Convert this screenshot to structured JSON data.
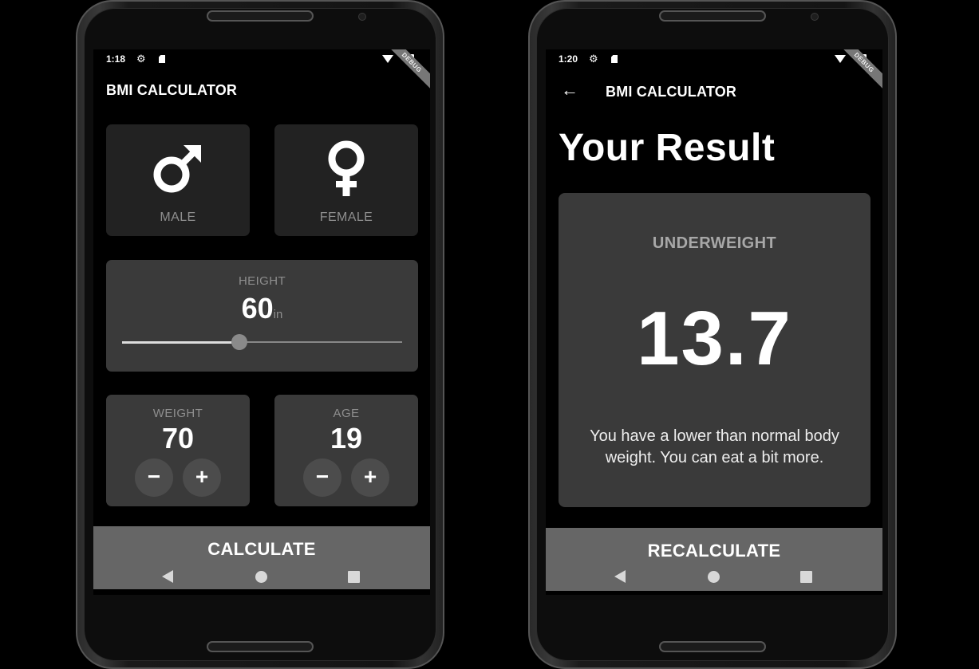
{
  "colors": {
    "background": "#000000",
    "card_inactive": "#222222",
    "card_active": "#3a3a3a",
    "bottom_button": "#666666",
    "label_grey": "#8e8e8e"
  },
  "input_screen": {
    "status_bar": {
      "time": "1:18",
      "debug_banner": "DEBUG"
    },
    "app_bar": {
      "title": "BMI CALCULATOR"
    },
    "gender": {
      "male": {
        "icon": "male-symbol-icon",
        "label": "MALE"
      },
      "female": {
        "icon": "female-symbol-icon",
        "label": "FEMALE"
      }
    },
    "height": {
      "label": "HEIGHT",
      "value": "60",
      "unit": "in",
      "slider_fraction": 0.42
    },
    "weight": {
      "label": "WEIGHT",
      "value": "70",
      "minus": "−",
      "plus": "+"
    },
    "age": {
      "label": "AGE",
      "value": "19",
      "minus": "−",
      "plus": "+"
    },
    "button_label": "CALCULATE"
  },
  "result_screen": {
    "status_bar": {
      "time": "1:20",
      "debug_banner": "DEBUG"
    },
    "app_bar": {
      "title": "BMI CALCULATOR",
      "back_icon": "arrow-back-icon"
    },
    "heading": "Your Result",
    "status": "UNDERWEIGHT",
    "bmi": "13.7",
    "message": "You have a lower than normal body weight. You can eat a bit more.",
    "button_label": "RECALCULATE"
  }
}
